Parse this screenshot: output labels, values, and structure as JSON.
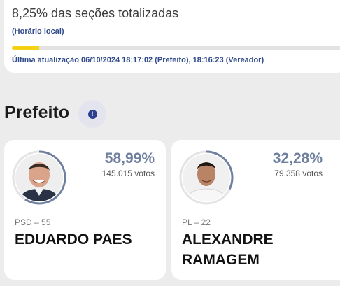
{
  "status": {
    "title": "8,25% das seções totalizadas",
    "subtitle": "(Horário local)",
    "progress_fraction": 0.0825,
    "progress_color": "#f3d215",
    "last_update": "Última atualização 06/10/2024 18:17:02 (Prefeito), 18:16:23 (Vereador)"
  },
  "section": {
    "title": "Prefeito",
    "info_icon": "info-icon",
    "info_symbol": "!"
  },
  "candidates": [
    {
      "percent": "58,99%",
      "percent_fraction": 0.5899,
      "votes": "145.015 votos",
      "party": "PSD – 55",
      "name": "EDUARDO PAES"
    },
    {
      "percent": "32,28%",
      "percent_fraction": 0.3228,
      "votes": "79.358 votos",
      "party": "PL – 22",
      "name": "ALEXANDRE RAMAGEM"
    }
  ],
  "colors": {
    "accent": "#6f7f9f",
    "link": "#2f4a8a",
    "ring_track": "#e3e3e3"
  }
}
